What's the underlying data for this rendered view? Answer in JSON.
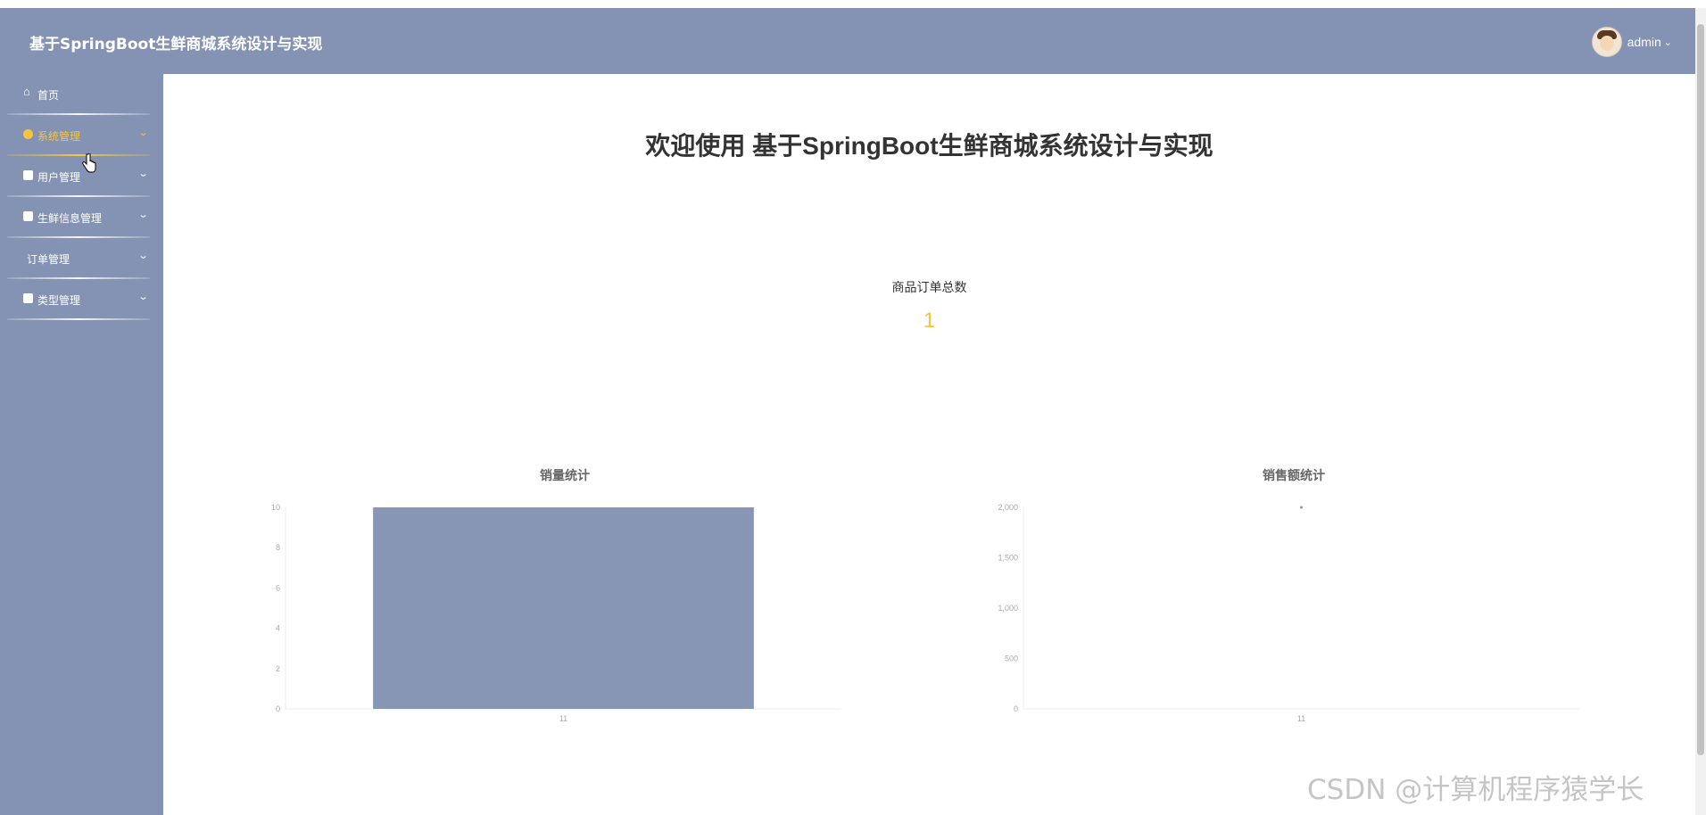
{
  "header": {
    "title": "基于SpringBoot生鲜商城系统设计与实现",
    "username": "admin",
    "bg_color": "#8493b3"
  },
  "sidebar": {
    "items": [
      {
        "label": "首页",
        "icon": "home-icon"
      },
      {
        "label": "系统管理",
        "icon": "dot-icon",
        "active": true
      },
      {
        "label": "用户管理",
        "icon": "square-icon"
      },
      {
        "label": "生鲜信息管理",
        "icon": "square-icon"
      },
      {
        "label": "订单管理",
        "icon": ""
      },
      {
        "label": "类型管理",
        "icon": "square-icon"
      }
    ],
    "accent_color": "#f5c542"
  },
  "main": {
    "welcome": "欢迎使用 基于SpringBoot生鲜商城系统设计与实现",
    "stat": {
      "label": "商品订单总数",
      "value": "1"
    }
  },
  "chart_data": [
    {
      "type": "bar",
      "title": "销量统计",
      "categories": [
        "11"
      ],
      "values": [
        10
      ],
      "ylim": [
        0,
        10
      ],
      "yticks": [
        "0",
        "2",
        "4",
        "6",
        "8",
        "10"
      ],
      "color": "#8796b4"
    },
    {
      "type": "scatter",
      "title": "销售额统计",
      "categories": [
        "11"
      ],
      "values": [
        2000
      ],
      "ylim": [
        0,
        2000
      ],
      "yticks": [
        "0",
        "500",
        "1,000",
        "1,500",
        "2,000"
      ],
      "color": "#8796b4"
    }
  ],
  "watermark": "CSDN @计算机程序猿学长"
}
